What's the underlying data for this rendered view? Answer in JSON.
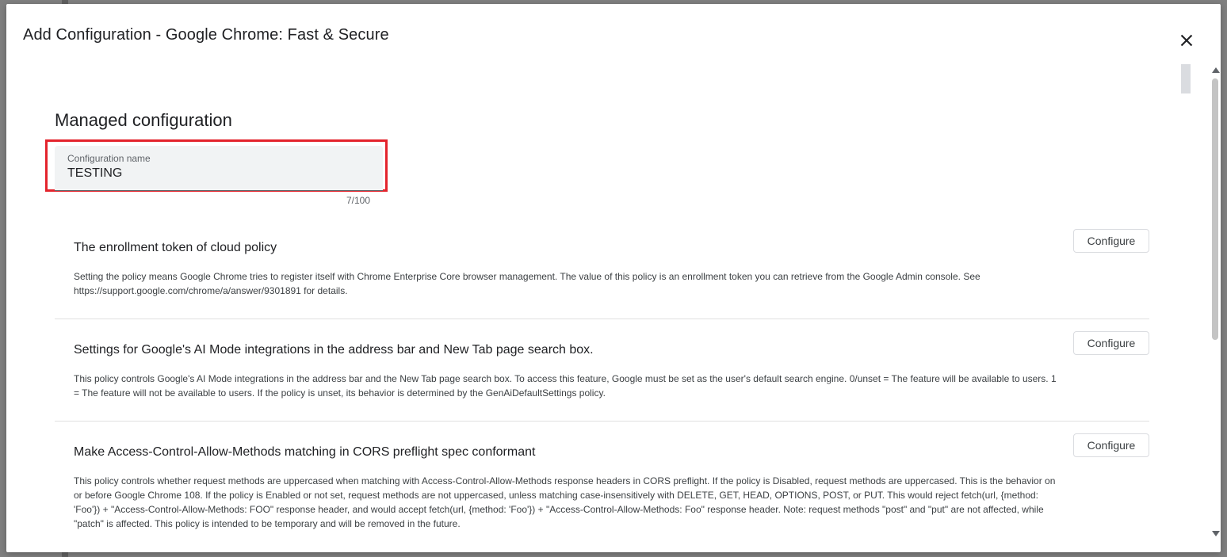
{
  "dialog": {
    "title": "Add Configuration - Google Chrome: Fast & Secure",
    "close_icon": "close-icon"
  },
  "managed": {
    "section_title": "Managed configuration",
    "field_label": "Configuration name",
    "field_value": "TESTING",
    "counter": "7/100"
  },
  "policies": [
    {
      "title": "The enrollment token of cloud policy",
      "description": "Setting the policy means Google Chrome tries to register itself with Chrome Enterprise Core browser management. The value of this policy is an enrollment token you can retrieve from the Google Admin console. See https://support.google.com/chrome/a/answer/9301891 for details.",
      "button": "Configure"
    },
    {
      "title": "Settings for Google's AI Mode integrations in the address bar and New Tab page search box.",
      "description": "This policy controls Google's AI Mode integrations in the address bar and the New Tab page search box. To access this feature, Google must be set as the user's default search engine. 0/unset = The feature will be available to users. 1 = The feature will not be available to users. If the policy is unset, its behavior is determined by the GenAiDefaultSettings policy.",
      "button": "Configure"
    },
    {
      "title": "Make Access-Control-Allow-Methods matching in CORS preflight spec conformant",
      "description": "This policy controls whether request methods are uppercased when matching with Access-Control-Allow-Methods response headers in CORS preflight. If the policy is Disabled, request methods are uppercased. This is the behavior on or before Google Chrome 108. If the policy is Enabled or not set, request methods are not uppercased, unless matching case-insensitively with DELETE, GET, HEAD, OPTIONS, POST, or PUT. This would reject fetch(url, {method: 'Foo'}) + \"Access-Control-Allow-Methods: FOO\" response header, and would accept fetch(url, {method: 'Foo'}) + \"Access-Control-Allow-Methods: Foo\" response header. Note: request methods \"post\" and \"put\" are not affected, while \"patch\" is affected. This policy is intended to be temporary and will be removed in the future.",
      "button": "Configure"
    }
  ],
  "colors": {
    "highlight": "#e3232c",
    "field_bg": "#f1f3f4"
  }
}
